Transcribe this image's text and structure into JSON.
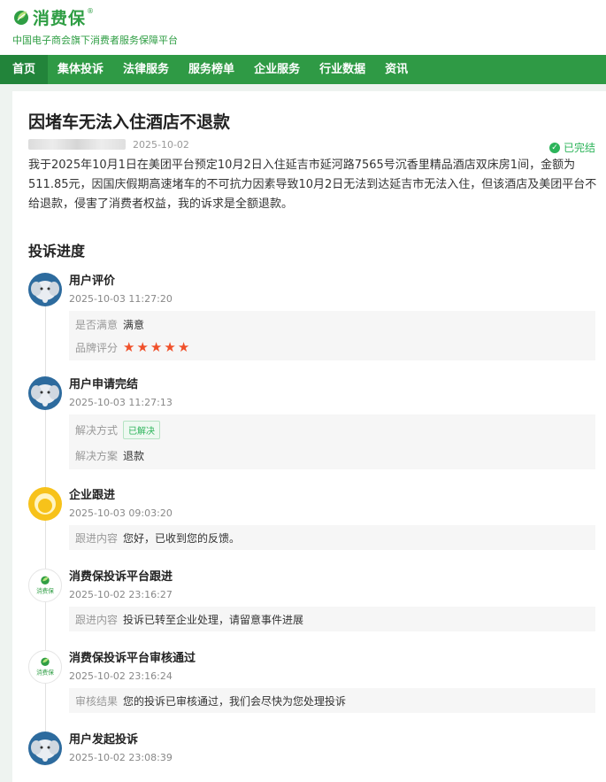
{
  "brand": {
    "name": "消费保",
    "reg": "®",
    "subtitle": "中国电子商会旗下消费者服务保障平台",
    "color": "#2f9e44"
  },
  "nav": {
    "items": [
      "首页",
      "集体投诉",
      "法律服务",
      "服务榜单",
      "企业服务",
      "行业数据",
      "资讯"
    ],
    "active": "首页",
    "color": "#2f9a45"
  },
  "complaint": {
    "title": "因堵车无法入住酒店不退款",
    "date": "2025-10-02",
    "status": "已完结",
    "status_icon": "check-circle-icon",
    "description": "我于2025年10月1日在美团平台预定10月2日入住延吉市延河路7565号沉香里精品酒店双床房1间，金额为511.85元，因国庆假期高速堵车的不可抗力因素导致10月2日无法到达延吉市无法入住，但该酒店及美团平台不给退款，侵害了消费者权益，我的诉求是全额退款。"
  },
  "progress": {
    "title": "投诉进度",
    "items": [
      {
        "avatar": "elephant-icon",
        "name": "用户评价",
        "time": "2025-10-03 11:27:20",
        "rows": [
          {
            "label": "是否满意",
            "value": "满意"
          },
          {
            "label": "品牌评分",
            "stars": 5
          }
        ]
      },
      {
        "avatar": "elephant-icon",
        "name": "用户申请完结",
        "time": "2025-10-03 11:27:13",
        "rows": [
          {
            "label": "解决方式",
            "badge": "已解决"
          },
          {
            "label": "解决方案",
            "value": "退款"
          }
        ]
      },
      {
        "avatar": "company-icon",
        "name": "企业跟进",
        "time": "2025-10-03 09:03:20",
        "rows": [
          {
            "label": "跟进内容",
            "value": "您好，已收到您的反馈。"
          }
        ]
      },
      {
        "avatar": "xiaofeibao-logo-icon",
        "avatar_text": "消费保",
        "name": "消费保投诉平台跟进",
        "time": "2025-10-02 23:16:27",
        "rows": [
          {
            "label": "跟进内容",
            "value": "投诉已转至企业处理，请留意事件进展"
          }
        ]
      },
      {
        "avatar": "xiaofeibao-logo-icon",
        "avatar_text": "消费保",
        "name": "消费保投诉平台审核通过",
        "time": "2025-10-02 23:16:24",
        "rows": [
          {
            "label": "审核结果",
            "value": "您的投诉已审核通过，我们会尽快为您处理投诉"
          }
        ]
      },
      {
        "avatar": "elephant-icon",
        "name": "用户发起投诉",
        "time": "2025-10-02 23:08:39",
        "rows": []
      }
    ]
  }
}
